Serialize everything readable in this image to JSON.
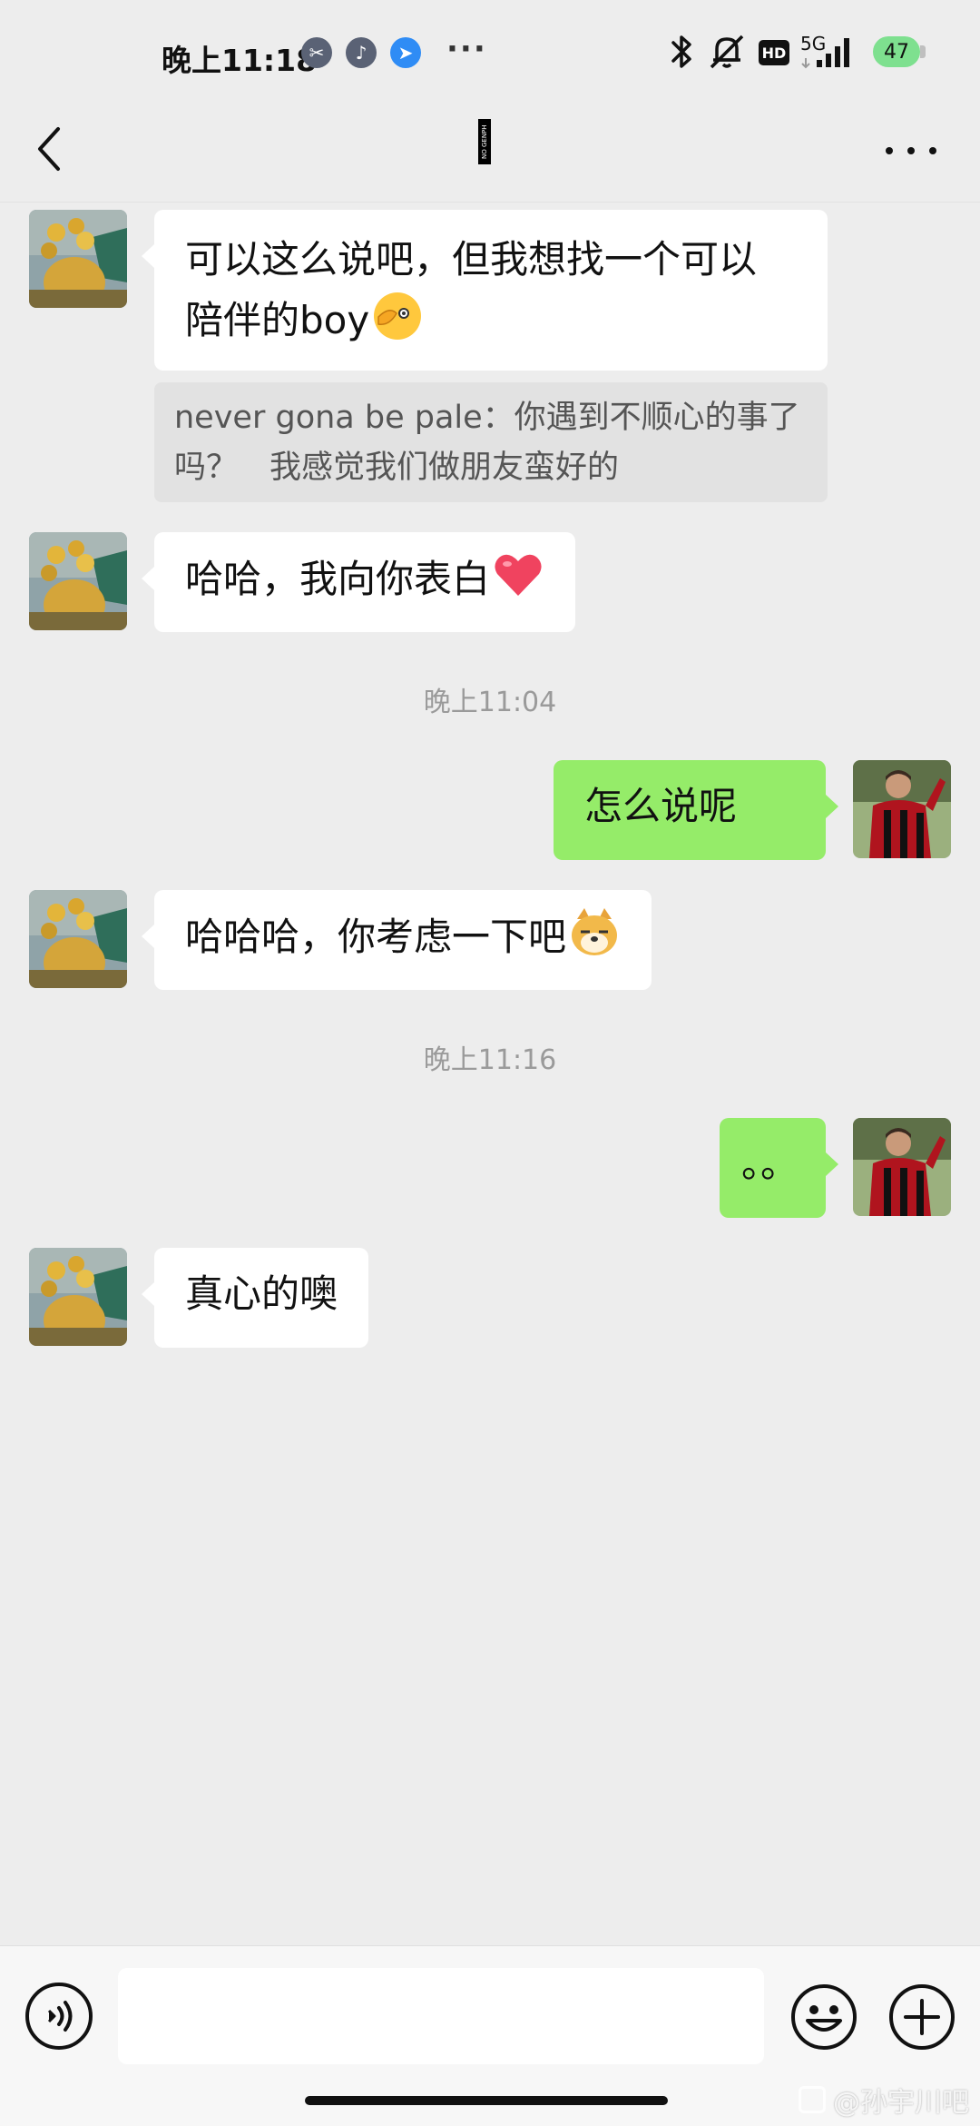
{
  "status_bar": {
    "time": "晚上11:18",
    "network": "5G",
    "hd_label": "HD",
    "battery": "47",
    "app_icons": [
      "scissors-app-icon",
      "tiktok-icon",
      "feishu-icon"
    ],
    "more": "···"
  },
  "title_bar": {
    "title_logo_text": "NO GENPH"
  },
  "messages": [
    {
      "side": "left",
      "text": "可以这么说吧，但我想找一个可以",
      "text2": "陪伴的boy"
    },
    {
      "quote": "never gona be pale：你遇到不顺心的事了吗？　我感觉我们做朋友蛮好的"
    },
    {
      "side": "left",
      "text": "哈哈，我向你表白"
    },
    {
      "timestamp": "晚上11:04"
    },
    {
      "side": "right",
      "text": "怎么说呢"
    },
    {
      "side": "left",
      "text": "哈哈哈，你考虑一下吧"
    },
    {
      "timestamp": "晚上11:16"
    },
    {
      "side": "right",
      "text": "。。"
    },
    {
      "side": "left",
      "text": "真心的噢"
    }
  ],
  "input": {
    "value": "",
    "placeholder": ""
  },
  "watermark": "@孙宇川吧",
  "colors": {
    "background": "#EDEDED",
    "sent_bubble": "#95EC69",
    "received_bubble": "#FFFFFF",
    "quote_bg": "#E2E2E2"
  }
}
